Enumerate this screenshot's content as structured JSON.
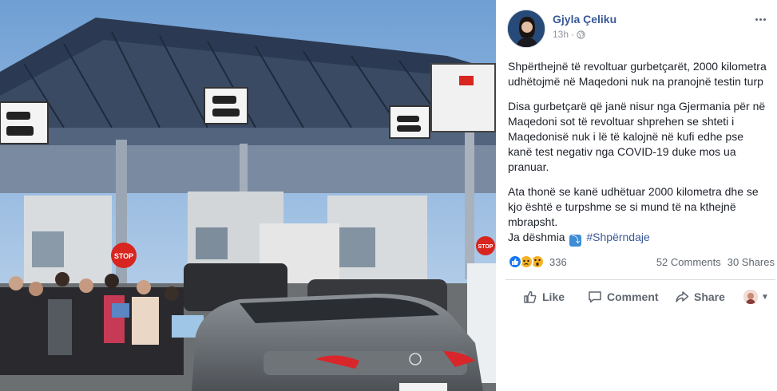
{
  "post": {
    "author": "Gjyla Çeliku",
    "time": "13h",
    "privacy_icon": "globe-icon",
    "paragraphs": [
      "Shpërthejnë të revoltuar gurbetçarët, 2000 kilometra udhëtojmë në Maqedoni nuk na pranojnë testin turp",
      "Disa gurbetçarë që janë nisur nga Gjermania për në Maqedoni sot të revoltuar shprehen se shteti i Maqedonisë nuk i lë të kalojnë në kufi edhe pse kanë test negativ nga COVID-19 duke mos ua pranuar.",
      "Ata thonë se kanë udhëtuar 2000 kilometra dhe se kjo është e turpshme se si mund të na kthejnë mbrapsht."
    ],
    "witness_prefix": "Ja dëshmia",
    "hashtag": "#Shpërndaje"
  },
  "stats": {
    "reaction_icons": [
      "like-icon",
      "sad-icon",
      "wow-icon"
    ],
    "reaction_count": "336",
    "comments": "52 Comments",
    "shares": "30 Shares"
  },
  "actions": {
    "like": "Like",
    "comment": "Comment",
    "share": "Share"
  },
  "photo_signs": {
    "stop_left": "STOP",
    "stop_right": "STOP"
  },
  "colors": {
    "author_link": "#385898",
    "secondary_text": "#606770",
    "like_blue": "#1877f2",
    "reaction_yellow": "#f7b125",
    "divider": "#dadde1"
  }
}
